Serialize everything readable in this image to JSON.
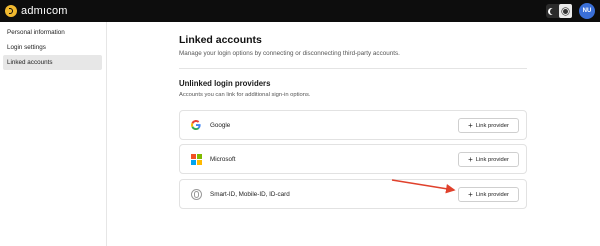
{
  "app": {
    "brand": "admıcom",
    "avatar_initials": "NU"
  },
  "sidebar": {
    "items": [
      {
        "label": "Personal information",
        "active": false
      },
      {
        "label": "Login settings",
        "active": false
      },
      {
        "label": "Linked accounts",
        "active": true
      }
    ]
  },
  "page": {
    "title": "Linked accounts",
    "subtitle": "Manage your login options by connecting or disconnecting third-party accounts."
  },
  "section": {
    "title": "Unlinked login providers",
    "subtitle": "Accounts you can link for additional sign-in options."
  },
  "providers": [
    {
      "name": "Google",
      "icon": "google-icon",
      "button_label": "Link provider"
    },
    {
      "name": "Microsoft",
      "icon": "microsoft-icon",
      "button_label": "Link provider"
    },
    {
      "name": "Smart-ID, Mobile-ID, ID-card",
      "icon": "fingerprint-icon",
      "button_label": "Link provider"
    }
  ],
  "colors": {
    "topbar": "#0d0d0d",
    "brand_accent": "#f1b92f",
    "avatar": "#3a6fd8",
    "annotation_arrow": "#e0412c",
    "microsoft": [
      "#f25022",
      "#7fba00",
      "#00a4ef",
      "#ffb900"
    ]
  }
}
